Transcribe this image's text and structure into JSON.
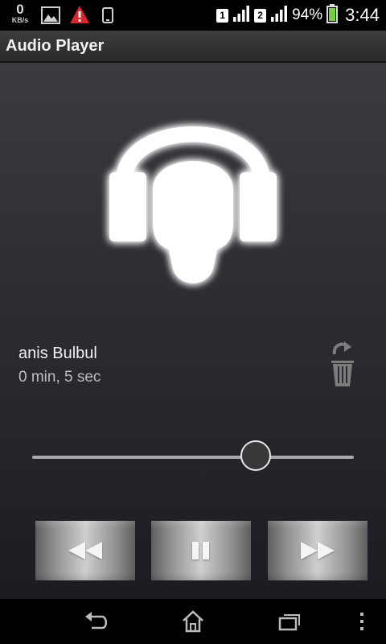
{
  "status_bar": {
    "network_speed": "0",
    "network_unit": "KB/s",
    "sim1_label": "1",
    "sim2_label": "2",
    "battery_percent": "94%",
    "time": "3:44",
    "icons": [
      "image-notification-icon",
      "warning-icon",
      "phone-icon",
      "signal-icon",
      "battery-icon"
    ]
  },
  "app": {
    "title": "Audio Player"
  },
  "player": {
    "track_title": "anis Bulbul",
    "duration": "0 min, 5 sec",
    "progress": 0.7,
    "controls": [
      "rewind",
      "pause",
      "fast-forward"
    ]
  },
  "nav_bar": {
    "buttons": [
      "back",
      "home",
      "recent-apps",
      "menu"
    ]
  },
  "colors": {
    "background_top": "#3a3a3f",
    "background_bottom": "#1b1c22",
    "warning_red": "#d9262b",
    "battery_green": "#73d13d"
  }
}
